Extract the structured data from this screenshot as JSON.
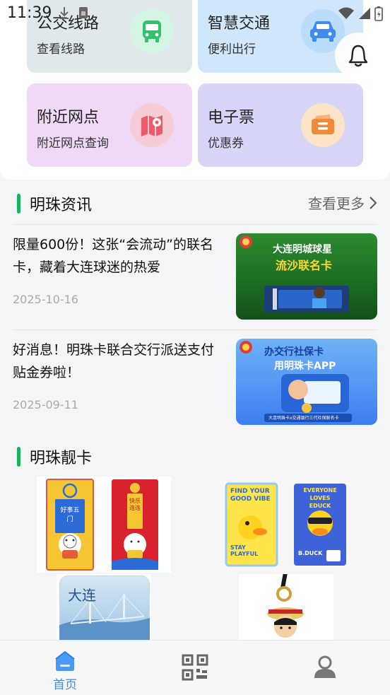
{
  "status": {
    "time": "11:39"
  },
  "tiles": [
    {
      "title": "公交线路",
      "subtitle": "查看线路",
      "icon": "bus-icon",
      "bg": "#dfe9ec",
      "accent": "#2fc46c"
    },
    {
      "title": "智慧交通",
      "subtitle": "便利出行",
      "icon": "car-icon",
      "bg": "#cfe6fb",
      "accent": "#3d8cf0"
    },
    {
      "title": "附近网点",
      "subtitle": "附近网点查询",
      "icon": "map-pin-icon",
      "bg": "#f0d9f6",
      "accent": "#ef5a6a"
    },
    {
      "title": "电子票",
      "subtitle": "优惠券",
      "icon": "ticket-icon",
      "bg": "#d8d6f8",
      "accent": "#f08a3a"
    }
  ],
  "news_section": {
    "title": "明珠资讯",
    "more": "查看更多",
    "items": [
      {
        "title": "限量600份！这张“会流动”的联名卡，藏着大连球迷的热爱",
        "date": "2025-10-16",
        "thumb_text_1": "大连明城球星",
        "thumb_text_2": "流沙联名卡"
      },
      {
        "title": "好消息！明珠卡联合交行派送支付贴金券啦！",
        "date": "2025-09-11",
        "thumb_text_1": "办交行社保卡",
        "thumb_text_2": "用明珠卡APP",
        "thumb_text_3": "大连明珠卡x交通银行三代社保联名卡"
      }
    ]
  },
  "cards_section": {
    "title": "明珠靓卡",
    "cards": [
      {
        "name": "lucky-cat-cards",
        "text_1": "好事五门",
        "text_2": "快乐连连"
      },
      {
        "name": "duck-cards",
        "text_1": "FIND YOUR GOOD VIBE",
        "text_2": "STAY PLAYFUL",
        "text_3": "EVERYONE LOVES EDUCK",
        "text_4": "B.DUCK"
      },
      {
        "name": "dalian-bridge-card",
        "text_1": "大连"
      },
      {
        "name": "one-piece-keychain",
        "text_1": ""
      }
    ]
  },
  "bottom_nav": {
    "items": [
      {
        "label": "首页",
        "icon": "home-icon",
        "active": true
      },
      {
        "label": "",
        "icon": "qr-code-icon",
        "active": false
      },
      {
        "label": "",
        "icon": "profile-icon",
        "active": false
      }
    ]
  }
}
